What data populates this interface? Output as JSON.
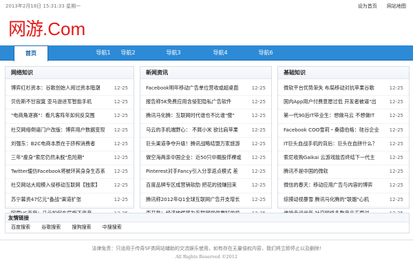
{
  "topbar": {
    "date": "2013年2月18日 15:31:33 星期一",
    "links": [
      "设为首页",
      "网站地图"
    ]
  },
  "logo": {
    "cn": "网游",
    "en": ".Com"
  },
  "nav": [
    "首页",
    "导航1",
    "导航2",
    "导航3",
    "导航4",
    "导航6"
  ],
  "columns": [
    {
      "title": "网络知识",
      "items": [
        {
          "t": "博弈红杉资本：谷歌创始人阅过资本暗潮",
          "d": "12-25"
        },
        {
          "t": "贝佐斯不甘寂寞 亚马逊进军智能手机",
          "d": "12-25"
        },
        {
          "t": "\"电商角逐赛\"：看凡客阵年如何反突围",
          "d": "12-25"
        },
        {
          "t": "社交网络倒逼门户改版：博弈用户数据变现",
          "d": "12-25"
        },
        {
          "t": "刘强东：B2C电商本质在于挤榨消费者",
          "d": "12-25"
        },
        {
          "t": "三年\"瘦身\"索尼仍然未脱\"危险期\"",
          "d": "12-25"
        },
        {
          "t": "Twitter缓仿Facebook将被环其身身生态系",
          "d": "12-25"
        },
        {
          "t": "社交网站大规模入侵移动互联网【独家】",
          "d": "12-25"
        },
        {
          "t": "苏宁募资47亿元\"备战\"渠道扩张",
          "d": "12-25"
        },
        {
          "t": "阿里VS百度：马云如何布局旗下资产",
          "d": "12-25"
        }
      ]
    },
    {
      "title": "新闻资讯",
      "items": [
        {
          "t": "Facebook明年移动广告单位营收或超桌面",
          "d": "12-25"
        },
        {
          "t": "报告称5K免费应用含侵犯隐私广告软件",
          "d": "12-25"
        },
        {
          "t": "腾讯马化腾：互联网时代谁也不比谁\"傻\"",
          "d": "12-25"
        },
        {
          "t": "马云的手机端野心： 不屑小米 欲比肩苹果",
          "d": "12-25"
        },
        {
          "t": "巨头渠道争夺升级！腾讯战略结盟万家旅游",
          "d": "12-25"
        },
        {
          "t": "做空海两亲中国企业：近50只中概股俘裸或",
          "d": "12-25"
        },
        {
          "t": "Pinterest对手Fancy引入分享返点模式 差",
          "d": "12-25"
        },
        {
          "t": "百度品牌专区成营销软肋 把花的钱赚回来",
          "d": "12-25"
        },
        {
          "t": "腾讯称2012年Q1全球互联网广告开支增长",
          "d": "12-25"
        },
        {
          "t": "李开复：经济放缓将为互联网提供更好的机",
          "d": "12-25"
        }
      ]
    },
    {
      "title": "基础知识",
      "items": [
        {
          "t": "微软平台优势渐失 布局移动对抗苹果谷歌",
          "d": "12-25"
        },
        {
          "t": "国内App用户付费意愿过低 开发者被逼\"出",
          "d": "12-25"
        },
        {
          "t": "第一代90后IT毕业生：想做马云 不想做IT",
          "d": "12-25"
        },
        {
          "t": "Facebook COO雪莉・桑德伯格：硅谷企业",
          "d": "12-25"
        },
        {
          "t": "IT巨头血战手机的背后：巨头在血拼什么？",
          "d": "12-25"
        },
        {
          "t": "索尼收购Gaikai 云游戏能否终结下一代主",
          "d": "12-25"
        },
        {
          "t": "腾讯不是中国的微软",
          "d": "12-25"
        },
        {
          "t": "微信的春天：移动应用广告与内容的博弈",
          "d": "12-25"
        },
        {
          "t": "综摸动视暴雪 腾讯马化腾的\"联姻\"心机",
          "d": "12-25"
        },
        {
          "t": "谁抢走谈光年 社交网络多款产品正面对",
          "d": "12-25"
        }
      ]
    }
  ],
  "friends": {
    "title": "友情链接",
    "links": [
      "百度搜索",
      "谷歌搜索",
      "搜狗搜索",
      "中搜搜索"
    ]
  },
  "footer": {
    "line1": "法律免责：只适用于传奇SF类网站辅助的交流娱乐使用，如有存在无量侵权内容，我们将立即停止以及删除!",
    "line2": "All Rights Reserved ©2012"
  }
}
